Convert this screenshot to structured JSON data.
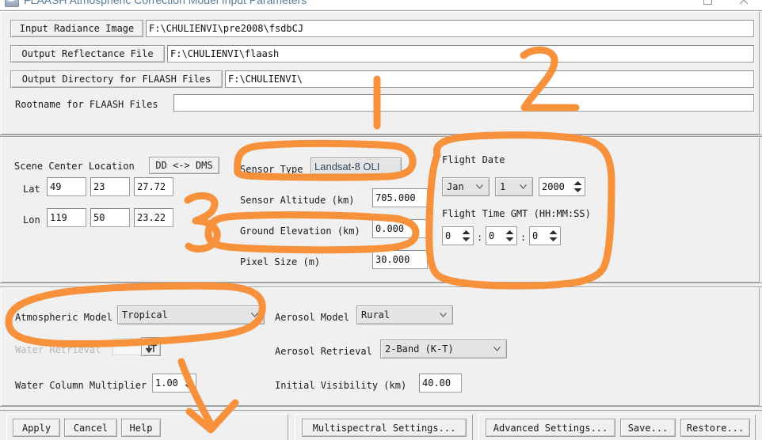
{
  "window": {
    "title": "FLAASH Atmospheric Correction Model Input Parameters",
    "icon": "flaash-app-icon",
    "maximize_label": "maximize-icon",
    "close_label": "close-icon"
  },
  "file_section": {
    "rows": [
      {
        "button_label": "Input Radiance Image",
        "value": "F:\\CHULIENVI\\pre2008\\fsdbCJ"
      },
      {
        "button_label": "Output Reflectance File",
        "value": "F:\\CHULIENVI\\flaash"
      },
      {
        "button_label": "Output Directory for FLAASH Files",
        "value": "F:\\CHULIENVI\\"
      }
    ],
    "rootname": {
      "label": "Rootname for FLAASH Files",
      "value": "",
      "placeholder": ""
    }
  },
  "scene_section": {
    "scene_center_label": "Scene Center Location",
    "dd_dms_button": "DD <-> DMS",
    "lat_label": "Lat",
    "lon_label": "Lon",
    "lat": {
      "deg": "49",
      "min": "23",
      "sec": "27.72"
    },
    "lon": {
      "deg": "119",
      "min": "50",
      "sec": "23.22"
    },
    "sensor_type_label": "Sensor Type",
    "sensor_type_value": "Landsat-8 OLI",
    "sensor_altitude_label": "Sensor Altitude (km)",
    "sensor_altitude_value": "705.000",
    "ground_elevation_label": "Ground Elevation (km)",
    "ground_elevation_value": "0.000",
    "pixel_size_label": "Pixel Size (m)",
    "pixel_size_value": "30.000",
    "flight_date_label": "Flight Date",
    "flight_month": "Jan",
    "flight_day": "1",
    "flight_year": "2000",
    "flight_time_label": "Flight Time GMT (HH:MM:SS)",
    "flight_hour": "0",
    "flight_minute": "0",
    "flight_second": "0",
    "time_sep": ":"
  },
  "model_section": {
    "atmospheric_model_label": "Atmospheric Model",
    "atmospheric_model_value": "Tropical",
    "water_retrieval_label": "Water Retrieval",
    "water_retrieval_value": "",
    "water_column_multiplier_label": "Water Column Multiplier",
    "water_column_multiplier_value": "1.00",
    "aerosol_model_label": "Aerosol Model",
    "aerosol_model_value": "Rural",
    "aerosol_retrieval_label": "Aerosol Retrieval",
    "aerosol_retrieval_value": "2-Band (K-T)",
    "initial_visibility_label": "Initial Visibility (km)",
    "initial_visibility_value": "40.00"
  },
  "footer": {
    "apply": "Apply",
    "cancel": "Cancel",
    "help": "Help",
    "multispectral": "Multispectral Settings...",
    "advanced": "Advanced Settings...",
    "save": "Save...",
    "restore": "Restore..."
  },
  "annotations": {
    "color": "#F7913C",
    "marks": [
      {
        "name": "annotation-digit-1",
        "text": "1"
      },
      {
        "name": "annotation-digit-2",
        "text": "2"
      },
      {
        "name": "annotation-digit-3",
        "text": "3"
      },
      {
        "name": "annotation-arrow-4",
        "text": "4"
      },
      {
        "name": "annotation-circle-sensor-type",
        "text": ""
      },
      {
        "name": "annotation-circle-ground-elevation",
        "text": ""
      },
      {
        "name": "annotation-circle-flight-date",
        "text": ""
      },
      {
        "name": "annotation-circle-atmospheric-model",
        "text": ""
      }
    ]
  }
}
